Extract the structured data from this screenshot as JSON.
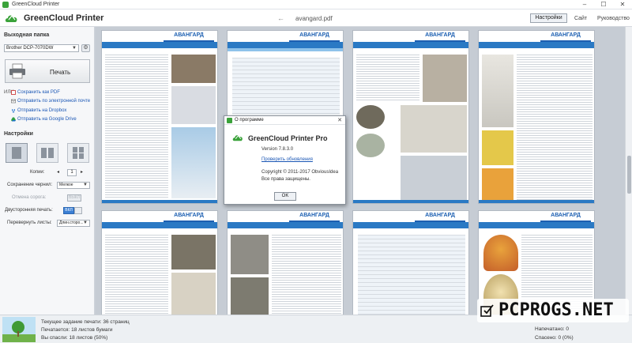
{
  "window": {
    "title": "GreenCloud Printer",
    "controls": [
      "–",
      "☐",
      "✕"
    ]
  },
  "header": {
    "brand": "GreenCloud Printer",
    "back": "←",
    "doc_name": "avangard.pdf",
    "settings": "Настройки",
    "site": "Сайт",
    "guide": "Руководство"
  },
  "left": {
    "output_folder_title": "Выходная папка",
    "printer": "Brother DCP-7070DW",
    "print": "Печать",
    "or": "ИЛИ",
    "links": [
      "Сохранить как PDF",
      "Отправить по электронной почте",
      "Отправить на Dropbox",
      "Отправить на Google Drive"
    ],
    "settings_title": "Настройки",
    "copies_label": "Копии:",
    "copies_value": "1",
    "ink_label": "Сохранение чернил:",
    "ink_value": "Мелкое",
    "reverse_label": "Отмена сорога:",
    "reverse_value": "ВЫКЛ",
    "duplex_label": "Двусторонняя печать:",
    "duplex_value": "ВКЛ",
    "flip_label": "Перевернуть листы:",
    "flip_value": "Длин.сторо..."
  },
  "dialog": {
    "title": "О программе",
    "product": "GreenCloud Printer Pro",
    "version": "Version 7.8.3.0",
    "update_link": "Проверить обновления",
    "copyright": "Copyright © 2011-2017 ObviousIdea",
    "rights": "Все права защищены.",
    "ok": "OK"
  },
  "page_logo": "АВАНГАРД",
  "status": {
    "line1": "Текущее задание печати: 36 страниц",
    "line2": "Печатается: 18 листов бумаги",
    "line3": "Вы спасли: 18 листов (50%)",
    "right1": "Напечатано: 0",
    "right2": "Спасено: 0 (0%)"
  },
  "watermark": "PCPROGS.NET",
  "colors": {
    "accent": "#2a79c4",
    "brand_green": "#3aa23a",
    "link": "#1b57b5"
  }
}
